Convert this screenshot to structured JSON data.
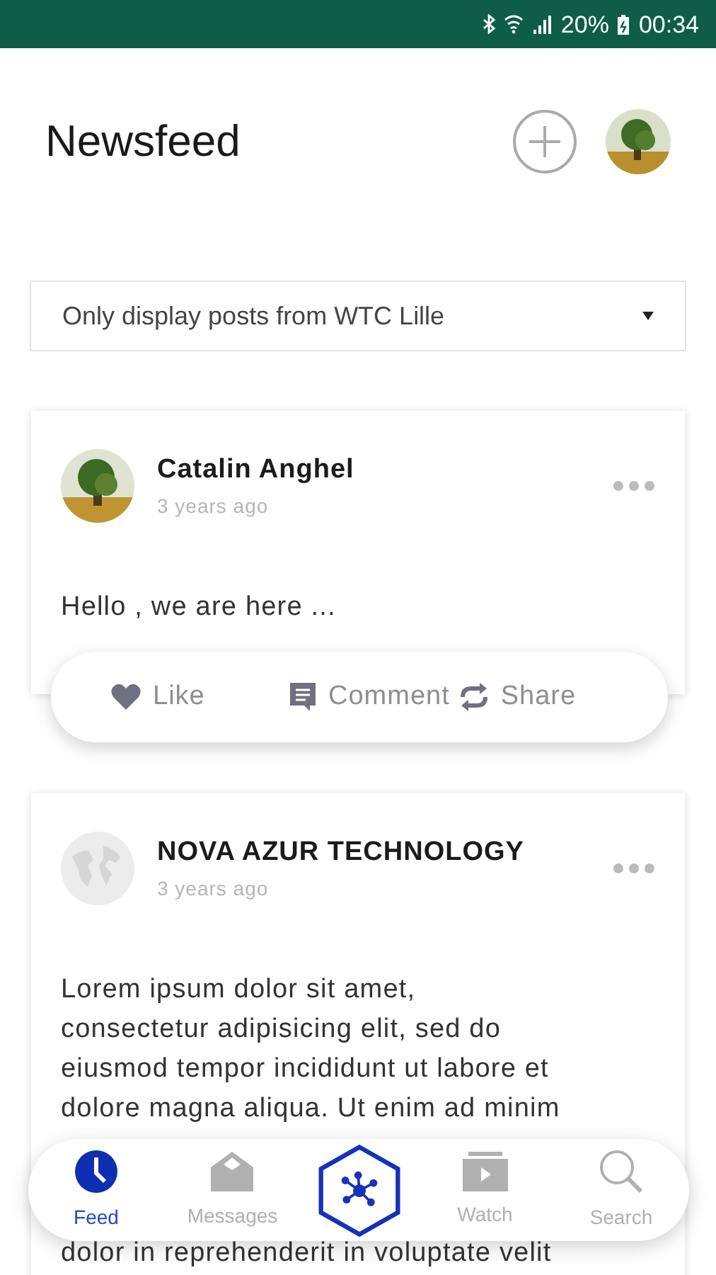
{
  "status_bar": {
    "battery": "20%",
    "time": "00:34"
  },
  "header": {
    "title": "Newsfeed"
  },
  "filter": {
    "value": "Only display posts from WTC Lille"
  },
  "posts": [
    {
      "author": "Catalin Anghel",
      "time": "3 years ago",
      "avatar": {
        "kind": "picture"
      },
      "lines": [
        "Hello , we are here ..."
      ],
      "actions": [
        {
          "kind": "like",
          "label": "Like"
        },
        {
          "kind": "comment",
          "label": "Comment"
        },
        {
          "kind": "share",
          "label": "Share"
        }
      ]
    },
    {
      "author": "NOVA AZUR TECHNOLOGY",
      "time": "3 years ago",
      "avatar": {
        "kind": "globe"
      },
      "lines": [
        "Lorem ipsum dolor sit amet,",
        "consectetur adipisicing elit, sed do",
        "eiusmod tempor incididunt ut labore et",
        "dolore magna aliqua. Ut enim ad minim",
        "dolor in reprehenderit in voluptate velit"
      ]
    }
  ],
  "nav": [
    {
      "kind": "feed",
      "label": "Feed",
      "selected": true
    },
    {
      "kind": "messages",
      "label": "Messages",
      "selected": false
    },
    {
      "kind": "center"
    },
    {
      "kind": "watch",
      "label": "Watch",
      "selected": false
    },
    {
      "kind": "search",
      "label": "Search",
      "selected": false
    }
  ]
}
